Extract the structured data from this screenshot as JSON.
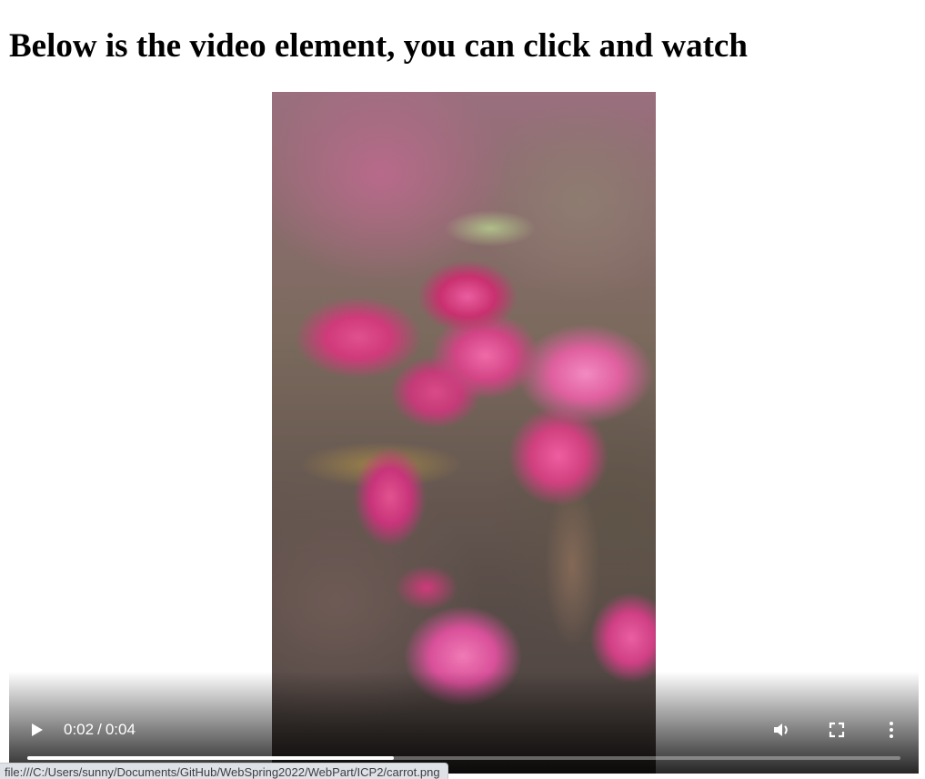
{
  "page": {
    "heading": "Below is the video element, you can click and watch"
  },
  "video": {
    "current_time": "0:02",
    "separator": "/",
    "duration": "0:04",
    "progress_fraction": 0.42,
    "controls": {
      "play_icon": "play-icon",
      "mute_icon": "volume-icon",
      "fullscreen_icon": "fullscreen-icon",
      "overflow_icon": "more-vert-icon"
    }
  },
  "status_bar": {
    "url": "file:///C:/Users/sunny/Documents/GitHub/WebSpring2022/WebPart/ICP2/carrot.png"
  },
  "colors": {
    "control_icon": "#ffffff",
    "progress_played": "#ffffff",
    "status_bar_bg": "#dee1e6"
  }
}
